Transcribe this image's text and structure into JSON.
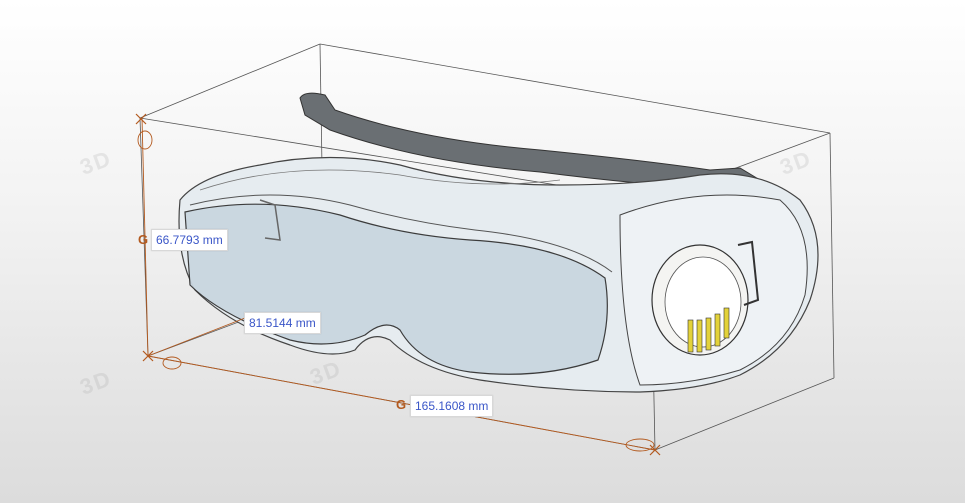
{
  "dimensions": {
    "height": "66.7793 mm",
    "depth": "81.5144 mm",
    "width": "165.1608 mm"
  },
  "watermark_text": "3D",
  "colors": {
    "dimension_text": "#3a56c8",
    "dimension_line": "#b35a1f",
    "bounding_box": "#555555",
    "lens": "#c9d6e0",
    "frame": "#e9eef2",
    "strap": "#5f6468"
  }
}
